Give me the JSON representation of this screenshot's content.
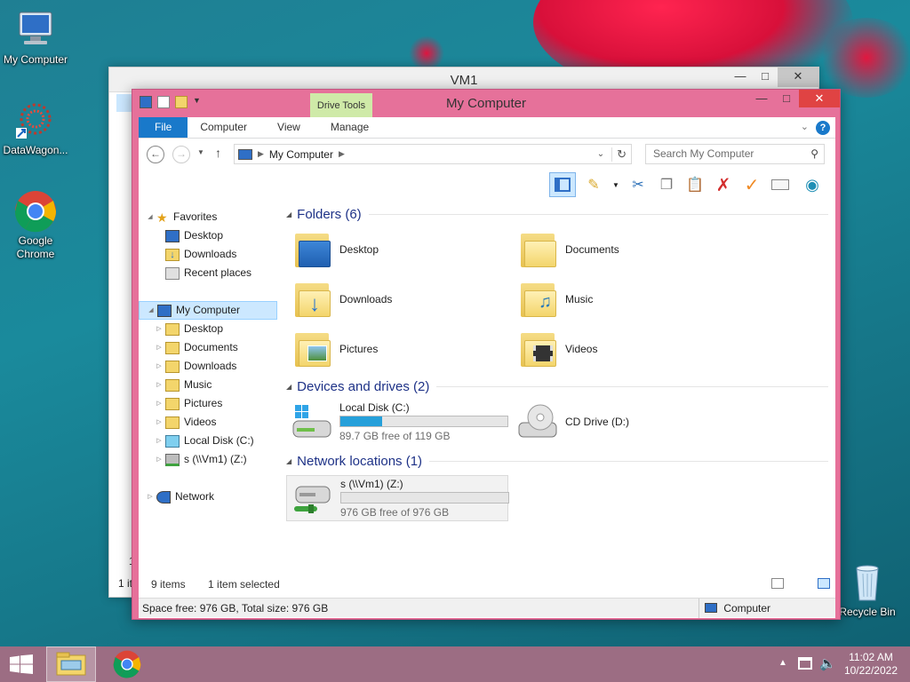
{
  "desktop": {
    "icons": [
      {
        "label": "My Computer"
      },
      {
        "label": "DataWagon..."
      },
      {
        "label": "Google Chrome"
      },
      {
        "label": "Recycle Bin"
      }
    ]
  },
  "back_window": {
    "title": "VM1",
    "fragment1": "1",
    "fragment2": "1 it"
  },
  "window": {
    "title": "My Computer",
    "context_tab": "Drive Tools",
    "ribbon_tabs": [
      "File",
      "Computer",
      "View",
      "Manage"
    ],
    "help_label": "?",
    "address": "My Computer",
    "search_placeholder": "Search My Computer",
    "nav": {
      "favorites": "Favorites",
      "favorite_items": [
        "Desktop",
        "Downloads",
        "Recent places"
      ],
      "computer": "My Computer",
      "computer_items": [
        "Desktop",
        "Documents",
        "Downloads",
        "Music",
        "Pictures",
        "Videos",
        "Local Disk (C:)",
        "s (\\\\Vm1) (Z:)"
      ],
      "network": "Network"
    },
    "sections": {
      "folders": "Folders (6)",
      "devices": "Devices and drives (2)",
      "network": "Network locations (1)"
    },
    "folders": [
      "Desktop",
      "Documents",
      "Downloads",
      "Music",
      "Pictures",
      "Videos"
    ],
    "drives": {
      "c": {
        "name": "Local Disk (C:)",
        "free": "89.7 GB free of 119 GB",
        "used_fraction": 0.25
      },
      "d": {
        "name": "CD Drive (D:)"
      },
      "z": {
        "name": "s (\\\\Vm1) (Z:)",
        "free": "976 GB free of 976 GB",
        "used_fraction": 0.0
      }
    },
    "status": {
      "items": "9 items",
      "selected": "1 item selected",
      "space": "Space free: 976 GB, Total size: 976 GB",
      "location": "Computer"
    }
  },
  "taskbar": {
    "time": "11:02 AM",
    "date": "10/22/2022"
  },
  "colors": {
    "accent": "#1979ca",
    "window_frame": "#e6719a",
    "close": "#e04343",
    "bar_fill": "#26a0da"
  }
}
